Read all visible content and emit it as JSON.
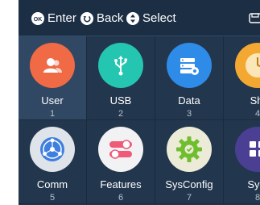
{
  "hints": {
    "ok_icon_text": "OK",
    "enter_label": "Enter",
    "back_label": "Back",
    "select_label": "Select"
  },
  "menu": {
    "items": [
      {
        "label": "User",
        "number": "1",
        "icon": "user-icon",
        "color": "#ef6a45",
        "selected": true
      },
      {
        "label": "USB",
        "number": "2",
        "icon": "usb-icon",
        "color": "#24c6b1"
      },
      {
        "label": "Data",
        "number": "3",
        "icon": "data-icon",
        "color": "#2f8be8"
      },
      {
        "label": "Shi",
        "number": "4",
        "icon": "clock-icon",
        "color": "#f3a832"
      },
      {
        "label": "Comm",
        "number": "5",
        "icon": "network-icon",
        "color": "#3f7fe0"
      },
      {
        "label": "Features",
        "number": "6",
        "icon": "toggle-icon",
        "color": "#ef5a77"
      },
      {
        "label": "SysConfig",
        "number": "7",
        "icon": "gear-icon",
        "color": "#6fbe2e"
      },
      {
        "label": "SysI",
        "number": "8",
        "icon": "info-icon",
        "color": "#4a3f93"
      }
    ]
  }
}
